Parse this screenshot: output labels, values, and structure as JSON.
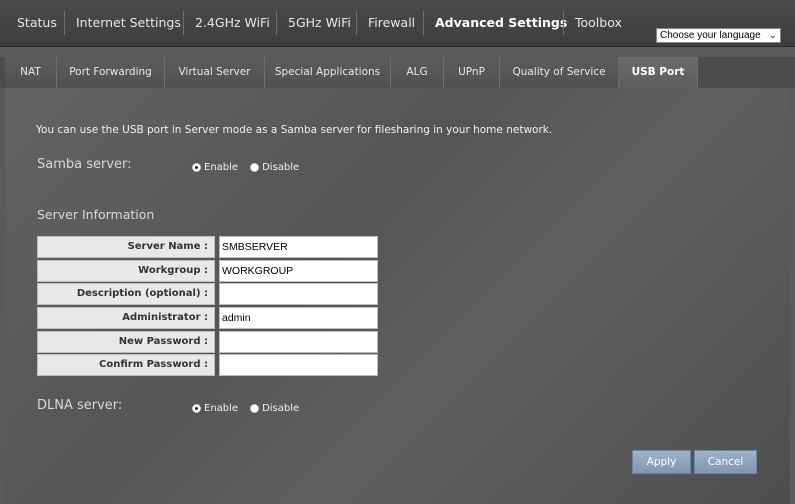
{
  "topnav": {
    "items": [
      {
        "label": "Status"
      },
      {
        "label": "Internet Settings"
      },
      {
        "label": "2.4GHz WiFi"
      },
      {
        "label": "5GHz WiFi"
      },
      {
        "label": "Firewall"
      },
      {
        "label": "Advanced Settings",
        "active": true
      },
      {
        "label": "Toolbox"
      }
    ],
    "language_select": "Choose your language"
  },
  "subtabs": [
    {
      "label": "NAT"
    },
    {
      "label": "Port Forwarding"
    },
    {
      "label": "Virtual Server"
    },
    {
      "label": "Special Applications"
    },
    {
      "label": "ALG"
    },
    {
      "label": "UPnP"
    },
    {
      "label": "Quality of Service"
    },
    {
      "label": "USB Port",
      "active": true
    }
  ],
  "main": {
    "intro": "You can use the USB port in Server mode as a Samba server for filesharing in your home network.",
    "samba": {
      "label": "Samba server:",
      "enable": "Enable",
      "disable": "Disable",
      "selected": "Enable"
    },
    "server_info_title": "Server Information",
    "fields": [
      {
        "label": "Server Name :",
        "value": "SMBSERVER"
      },
      {
        "label": "Workgroup :",
        "value": "WORKGROUP"
      },
      {
        "label": "Description (optional) :",
        "value": ""
      },
      {
        "label": "Administrator :",
        "value": "admin"
      },
      {
        "label": "New Password :",
        "value": ""
      },
      {
        "label": "Confirm Password :",
        "value": ""
      }
    ],
    "dlna": {
      "label": "DLNA server:",
      "enable": "Enable",
      "disable": "Disable",
      "selected": "Enable"
    },
    "apply_label": "Apply",
    "cancel_label": "Cancel"
  }
}
